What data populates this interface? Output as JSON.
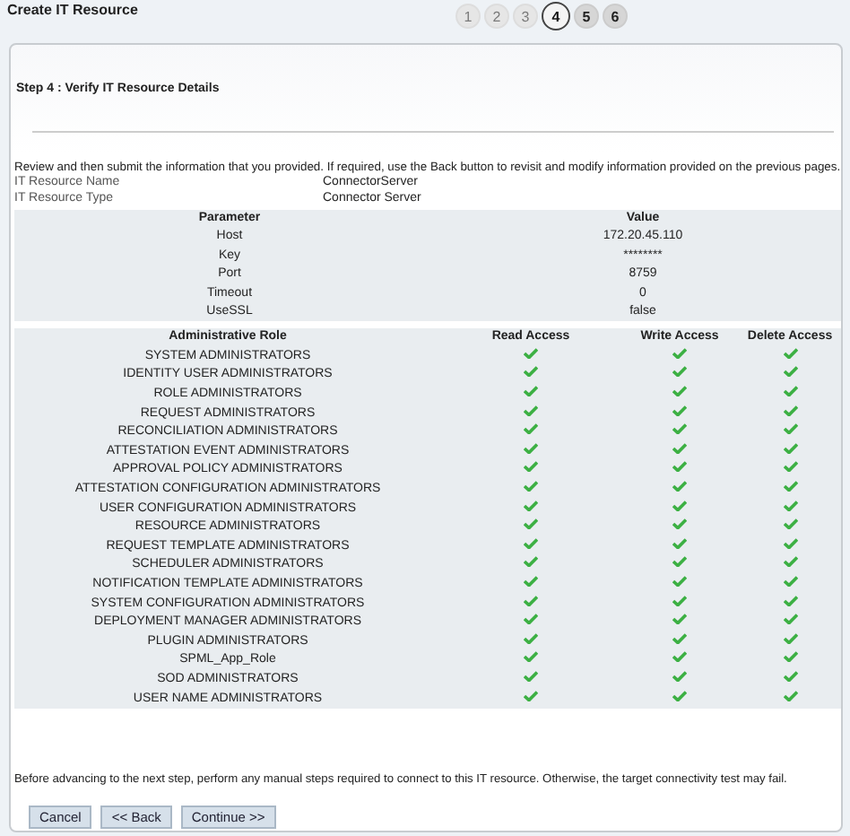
{
  "page_title": "Create IT Resource",
  "steps": [
    {
      "label": "1",
      "selected": false,
      "disabled": true
    },
    {
      "label": "2",
      "selected": false,
      "disabled": true
    },
    {
      "label": "3",
      "selected": false,
      "disabled": true
    },
    {
      "label": "4",
      "selected": true,
      "disabled": false
    },
    {
      "label": "5",
      "selected": false,
      "disabled": false
    },
    {
      "label": "6",
      "selected": false,
      "disabled": false
    }
  ],
  "step_heading": "Step 4 : Verify IT Resource Details",
  "instructions": "Review and then submit the information that you provided. If required, use the Back button to revisit and modify information provided on the previous pages.",
  "resource_info": [
    {
      "label": "IT Resource Name",
      "value": "ConnectorServer"
    },
    {
      "label": "IT Resource Type",
      "value": "Connector Server"
    }
  ],
  "parameters_table": {
    "columns": [
      "Parameter",
      "Value"
    ],
    "rows": [
      [
        "Host",
        "172.20.45.110"
      ],
      [
        "Key",
        "********"
      ],
      [
        "Port",
        "8759"
      ],
      [
        "Timeout",
        "0"
      ],
      [
        "UseSSL",
        "false"
      ]
    ]
  },
  "roles_table": {
    "columns": [
      "Administrative Role",
      "Read Access",
      "Write Access",
      "Delete Access"
    ],
    "rows": [
      {
        "role": "SYSTEM ADMINISTRATORS",
        "read": true,
        "write": true,
        "delete": true
      },
      {
        "role": "IDENTITY USER ADMINISTRATORS",
        "read": true,
        "write": true,
        "delete": true
      },
      {
        "role": "ROLE ADMINISTRATORS",
        "read": true,
        "write": true,
        "delete": true
      },
      {
        "role": "REQUEST ADMINISTRATORS",
        "read": true,
        "write": true,
        "delete": true
      },
      {
        "role": "RECONCILIATION ADMINISTRATORS",
        "read": true,
        "write": true,
        "delete": true
      },
      {
        "role": "ATTESTATION EVENT ADMINISTRATORS",
        "read": true,
        "write": true,
        "delete": true
      },
      {
        "role": "APPROVAL POLICY ADMINISTRATORS",
        "read": true,
        "write": true,
        "delete": true
      },
      {
        "role": "ATTESTATION CONFIGURATION ADMINISTRATORS",
        "read": true,
        "write": true,
        "delete": true
      },
      {
        "role": "USER CONFIGURATION ADMINISTRATORS",
        "read": true,
        "write": true,
        "delete": true
      },
      {
        "role": "RESOURCE ADMINISTRATORS",
        "read": true,
        "write": true,
        "delete": true
      },
      {
        "role": "REQUEST TEMPLATE ADMINISTRATORS",
        "read": true,
        "write": true,
        "delete": true
      },
      {
        "role": "SCHEDULER ADMINISTRATORS",
        "read": true,
        "write": true,
        "delete": true
      },
      {
        "role": "NOTIFICATION TEMPLATE ADMINISTRATORS",
        "read": true,
        "write": true,
        "delete": true
      },
      {
        "role": "SYSTEM CONFIGURATION ADMINISTRATORS",
        "read": true,
        "write": true,
        "delete": true
      },
      {
        "role": "DEPLOYMENT MANAGER ADMINISTRATORS",
        "read": true,
        "write": true,
        "delete": true
      },
      {
        "role": "PLUGIN ADMINISTRATORS",
        "read": true,
        "write": true,
        "delete": true
      },
      {
        "role": "SPML_App_Role",
        "read": true,
        "write": true,
        "delete": true
      },
      {
        "role": "SOD ADMINISTRATORS",
        "read": true,
        "write": true,
        "delete": true
      },
      {
        "role": "USER NAME ADMINISTRATORS",
        "read": true,
        "write": true,
        "delete": true
      }
    ]
  },
  "note": "Before advancing to the next step, perform any manual steps required to connect to this IT resource. Otherwise, the target connectivity test may fail.",
  "buttons": [
    "Cancel",
    "<< Back",
    "Continue >>"
  ]
}
